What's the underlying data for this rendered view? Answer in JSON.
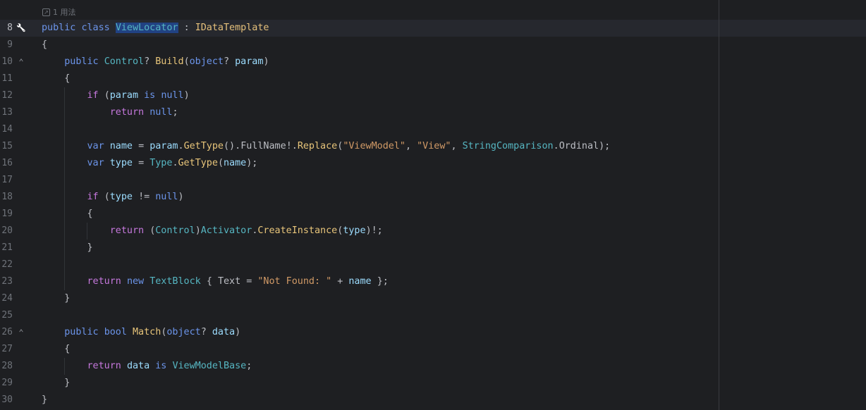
{
  "usage_hint": "1 用法",
  "lines": [
    {
      "n": "8",
      "icon": "wrench-icon",
      "code": "public class ViewLocator : IDataTemplate"
    },
    {
      "n": "9",
      "icon": "",
      "code": "{"
    },
    {
      "n": "10",
      "icon": "override-arrow-icon",
      "code": "    public Control? Build(object? param)"
    },
    {
      "n": "11",
      "icon": "",
      "code": "    {"
    },
    {
      "n": "12",
      "icon": "",
      "code": "        if (param is null)"
    },
    {
      "n": "13",
      "icon": "",
      "code": "            return null;"
    },
    {
      "n": "14",
      "icon": "",
      "code": ""
    },
    {
      "n": "15",
      "icon": "",
      "code": "        var name = param.GetType().FullName!.Replace(\"ViewModel\", \"View\", StringComparison.Ordinal);"
    },
    {
      "n": "16",
      "icon": "",
      "code": "        var type = Type.GetType(name);"
    },
    {
      "n": "17",
      "icon": "",
      "code": ""
    },
    {
      "n": "18",
      "icon": "",
      "code": "        if (type != null)"
    },
    {
      "n": "19",
      "icon": "",
      "code": "        {"
    },
    {
      "n": "20",
      "icon": "",
      "code": "            return (Control)Activator.CreateInstance(type)!;"
    },
    {
      "n": "21",
      "icon": "",
      "code": "        }"
    },
    {
      "n": "22",
      "icon": "",
      "code": ""
    },
    {
      "n": "23",
      "icon": "",
      "code": "        return new TextBlock { Text = \"Not Found: \" + name };"
    },
    {
      "n": "24",
      "icon": "",
      "code": "    }"
    },
    {
      "n": "25",
      "icon": "",
      "code": ""
    },
    {
      "n": "26",
      "icon": "override-arrow-icon",
      "code": "    public bool Match(object? data)"
    },
    {
      "n": "27",
      "icon": "",
      "code": "    {"
    },
    {
      "n": "28",
      "icon": "",
      "code": "        return data is ViewModelBase;"
    },
    {
      "n": "29",
      "icon": "",
      "code": "    }"
    },
    {
      "n": "30",
      "icon": "",
      "code": "}"
    }
  ],
  "colors": {
    "background": "#1e1f22",
    "keyword": "#6c95eb",
    "control_keyword": "#c678dd",
    "type": "#56b6c2",
    "method": "#e8c57a",
    "string": "#d19a66",
    "selection": "#214283"
  }
}
